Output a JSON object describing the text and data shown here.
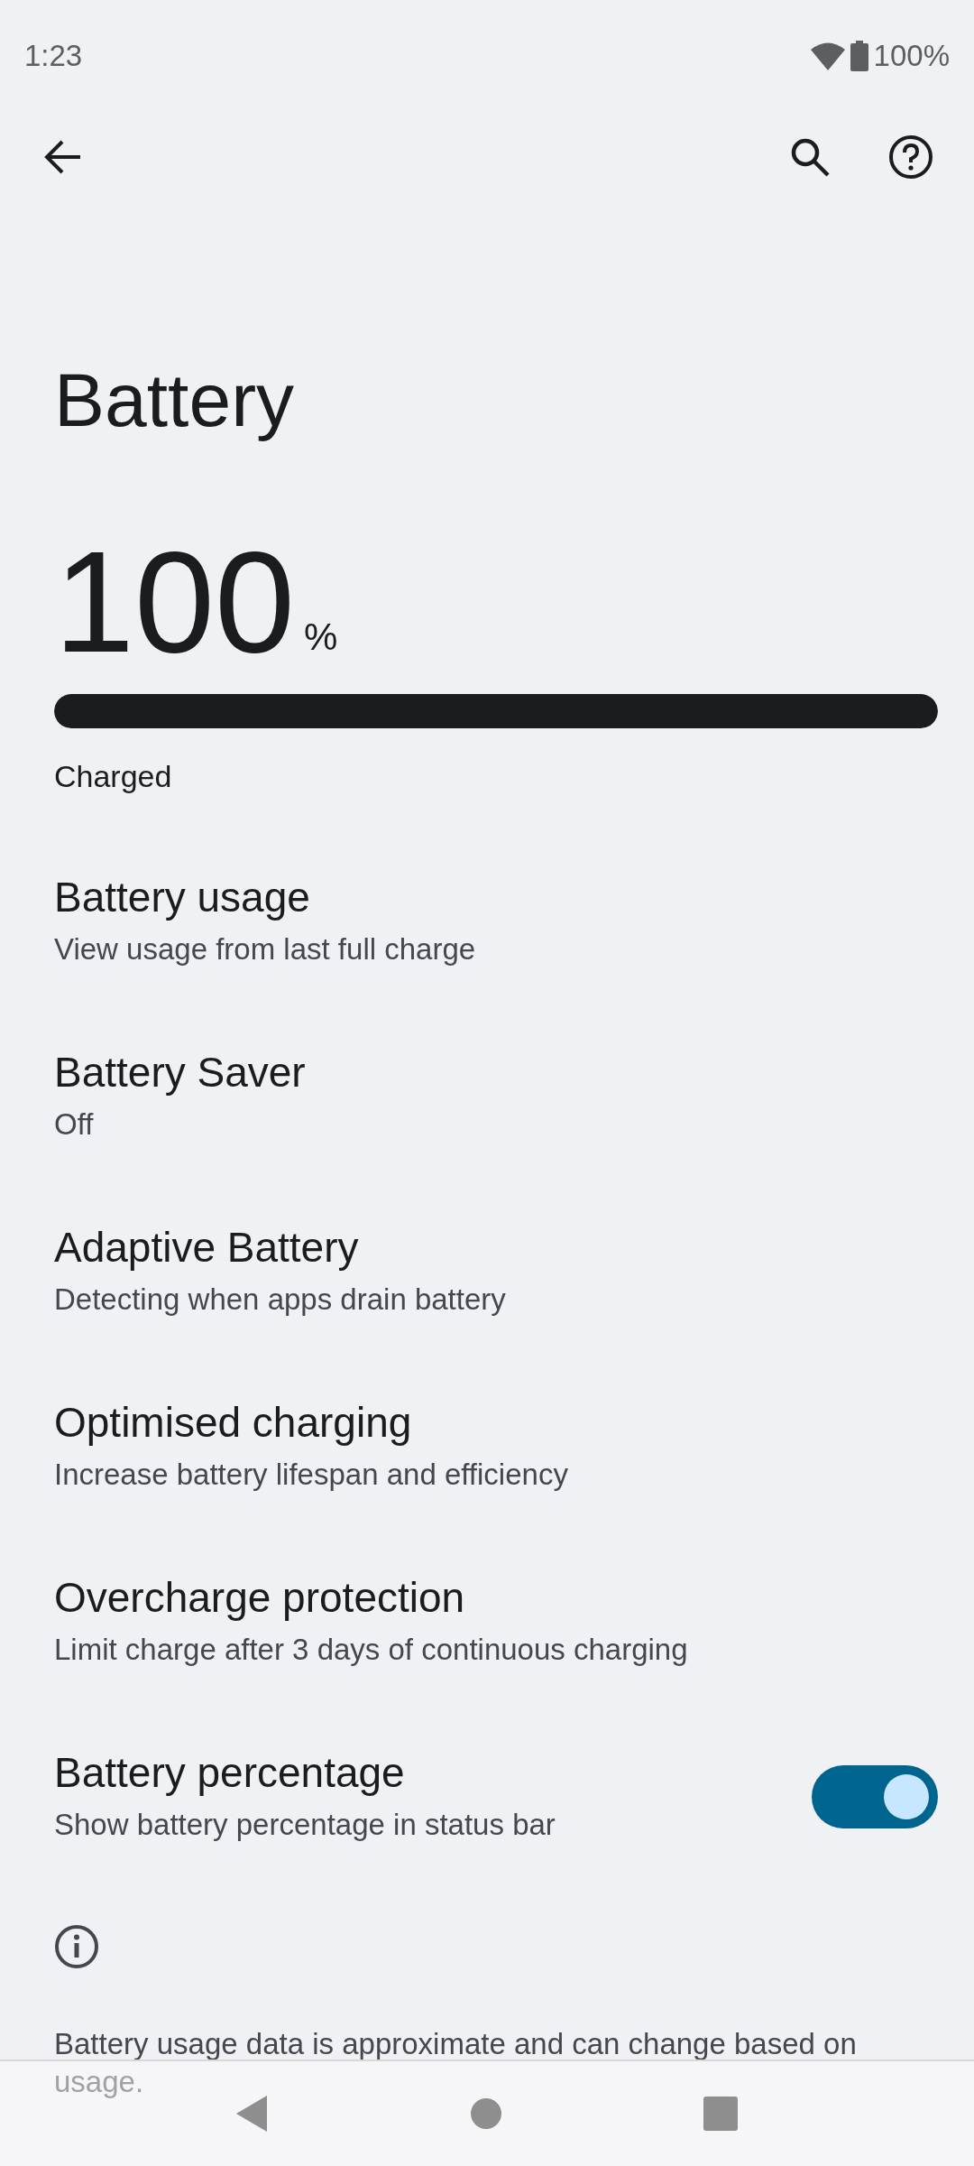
{
  "status_bar": {
    "time": "1:23",
    "battery_text": "100%"
  },
  "title": "Battery",
  "battery": {
    "percent": "100",
    "unit": "%",
    "level": 1,
    "status": "Charged"
  },
  "items": [
    {
      "kind": "link",
      "title": "Battery usage",
      "subtitle": "View usage from last full charge"
    },
    {
      "kind": "link",
      "title": "Battery Saver",
      "subtitle": "Off"
    },
    {
      "kind": "link",
      "title": "Adaptive Battery",
      "subtitle": "Detecting when apps drain battery"
    },
    {
      "kind": "link",
      "title": "Optimised charging",
      "subtitle": "Increase battery lifespan and efficiency"
    },
    {
      "kind": "link",
      "title": "Overcharge protection",
      "subtitle": "Limit charge after 3 days of continuous charging"
    },
    {
      "kind": "toggle",
      "title": "Battery percentage",
      "subtitle": "Show battery percentage in status bar",
      "on": true
    }
  ],
  "footer": "Battery usage data is approximate and can change based on usage."
}
